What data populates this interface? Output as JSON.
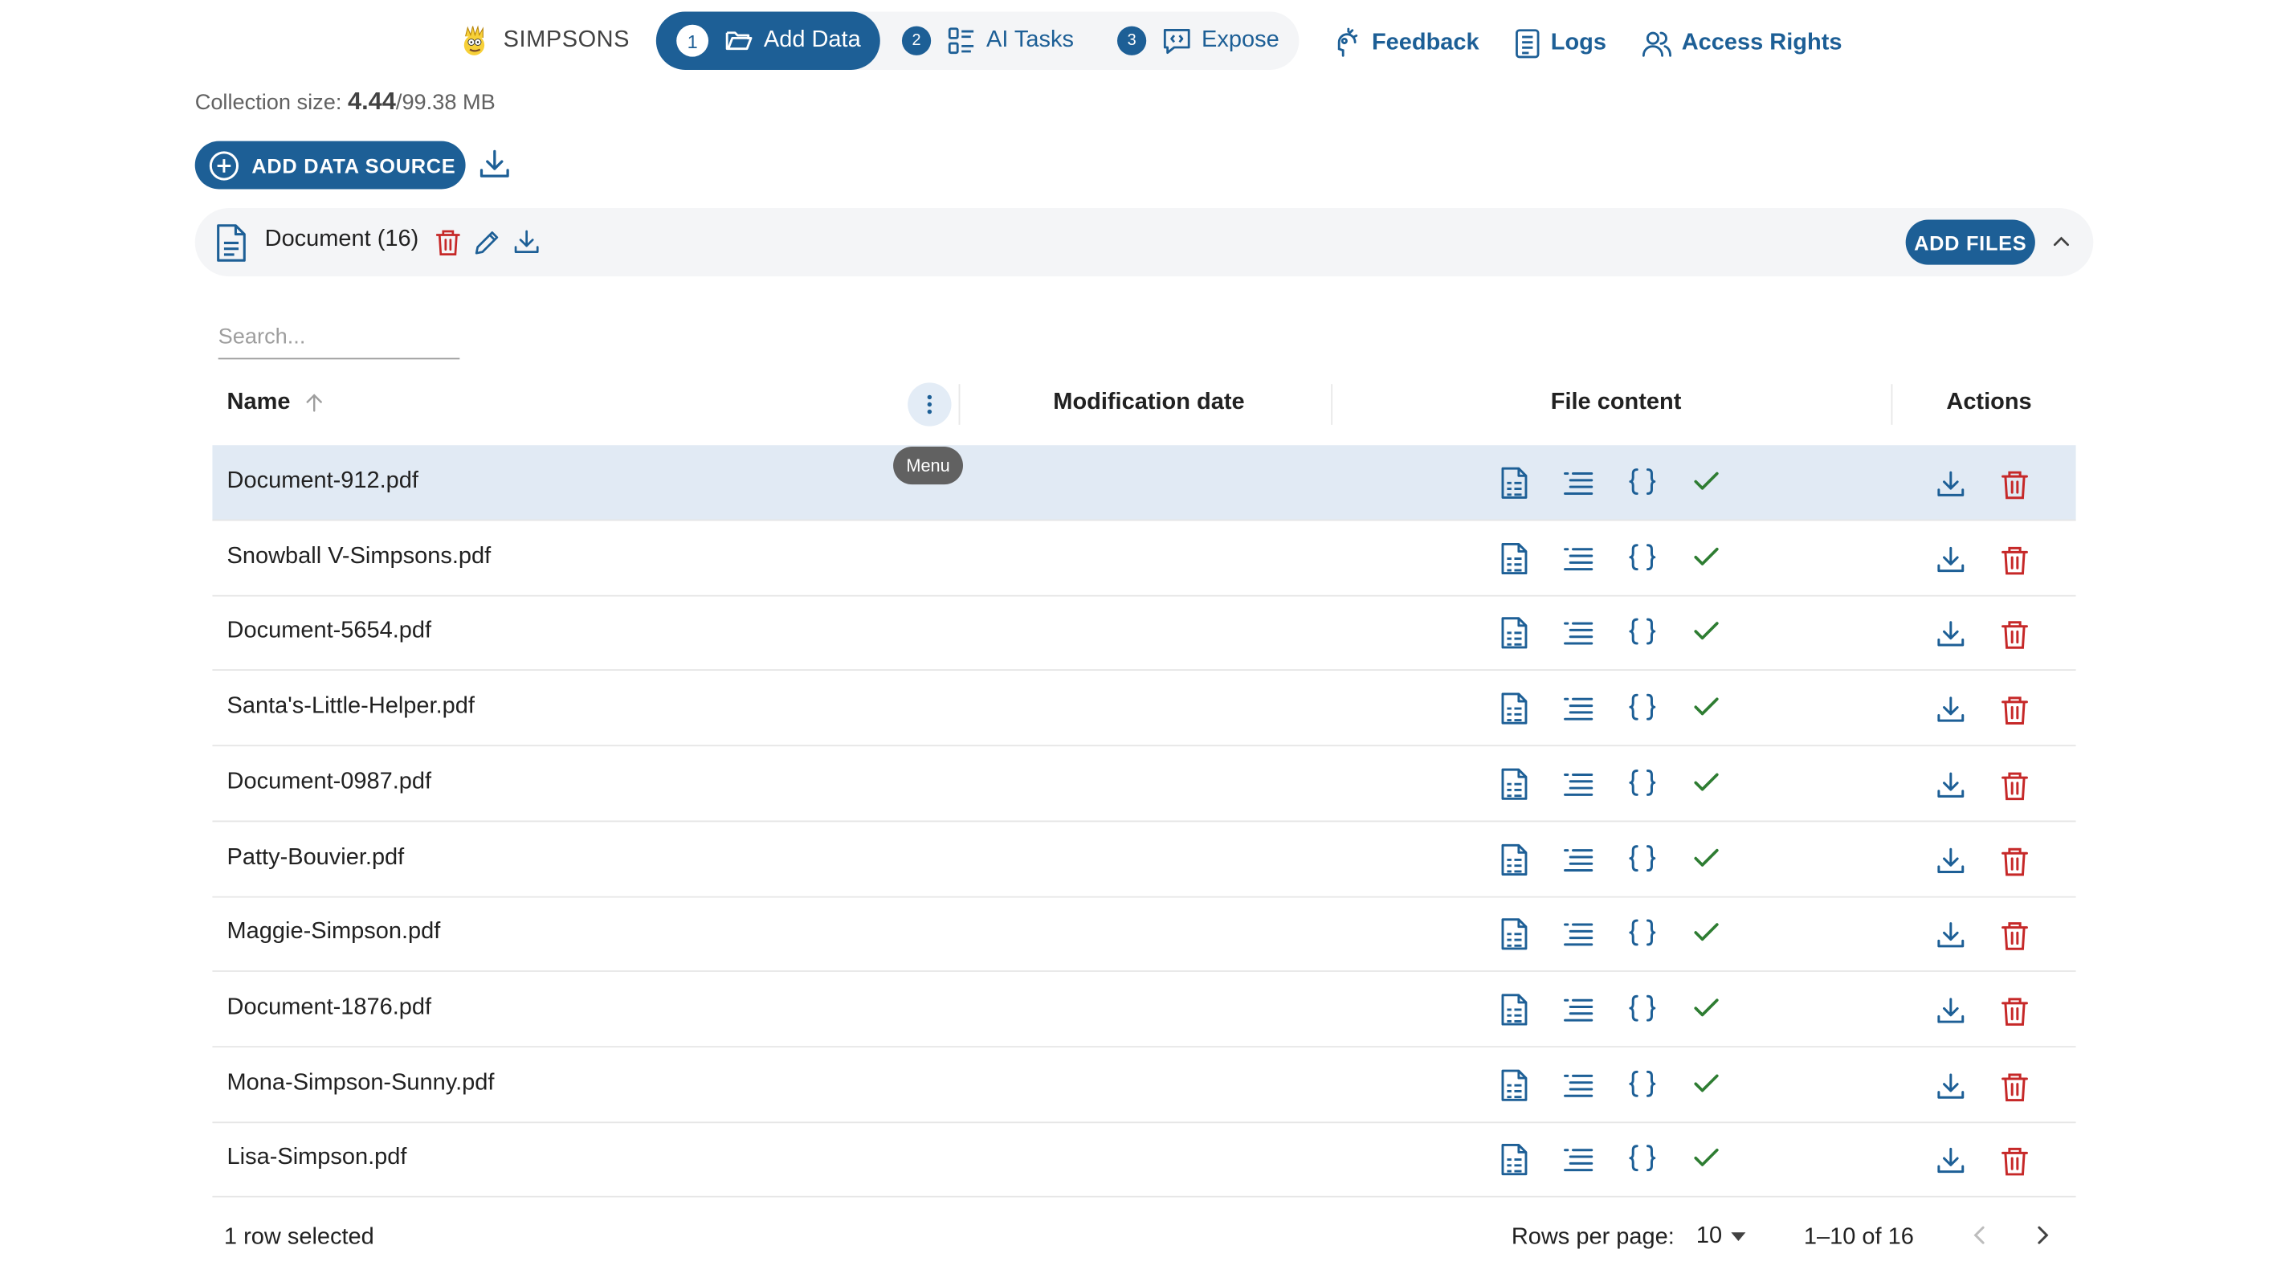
{
  "app": {
    "name": "SIMPSONS"
  },
  "stepper": {
    "steps": [
      {
        "num": "1",
        "label": "Add Data",
        "active": true
      },
      {
        "num": "2",
        "label": "AI Tasks",
        "active": false
      },
      {
        "num": "3",
        "label": "Expose",
        "active": false
      }
    ]
  },
  "nav": {
    "feedback": "Feedback",
    "logs": "Logs",
    "access": "Access Rights"
  },
  "collection": {
    "label": "Collection size: ",
    "used": "4.44",
    "total": "/99.38 MB"
  },
  "toolbar": {
    "add_source": "ADD DATA SOURCE"
  },
  "source": {
    "title": "Document (16)",
    "add_files": "ADD FILES"
  },
  "search": {
    "placeholder": "Search..."
  },
  "table": {
    "headers": {
      "name": "Name",
      "modified": "Modification date",
      "content": "File content",
      "actions": "Actions"
    },
    "menu_tooltip": "Menu",
    "rows": [
      {
        "name": "Document-912.pdf",
        "selected": true
      },
      {
        "name": "Snowball V-Simpsons.pdf",
        "selected": false
      },
      {
        "name": "Document-5654.pdf",
        "selected": false
      },
      {
        "name": "Santa's-Little-Helper.pdf",
        "selected": false
      },
      {
        "name": "Document-0987.pdf",
        "selected": false
      },
      {
        "name": "Patty-Bouvier.pdf",
        "selected": false
      },
      {
        "name": "Maggie-Simpson.pdf",
        "selected": false
      },
      {
        "name": "Document-1876.pdf",
        "selected": false
      },
      {
        "name": "Mona-Simpson-Sunny.pdf",
        "selected": false
      },
      {
        "name": "Lisa-Simpson.pdf",
        "selected": false
      }
    ]
  },
  "footer": {
    "selected": "1 row selected",
    "rows_per_page_label": "Rows per page:",
    "rows_per_page": "10",
    "range": "1–10 of 16"
  },
  "colors": {
    "primary": "#1d5f96",
    "danger": "#c62828",
    "success": "#2e7d32",
    "selected_row": "#e1eaf4"
  }
}
